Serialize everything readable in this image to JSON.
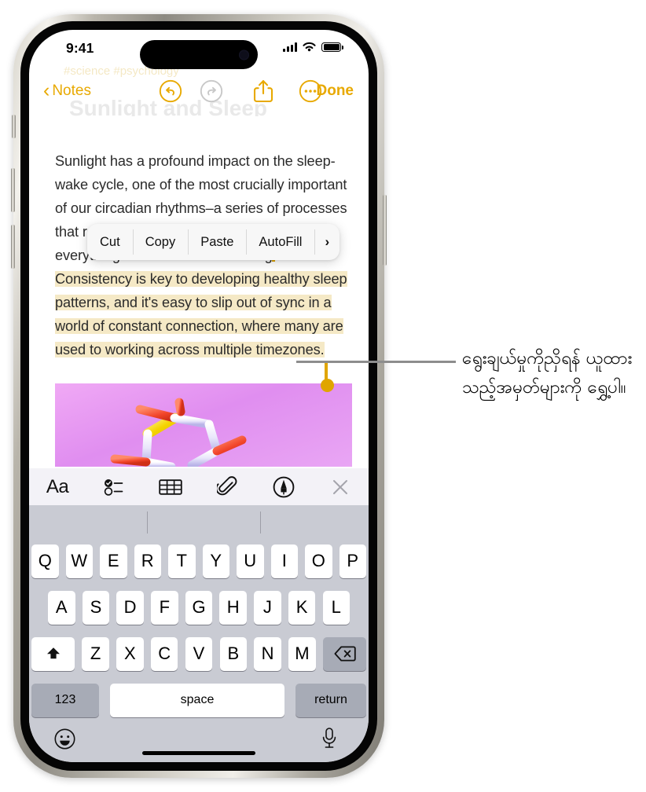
{
  "status_bar": {
    "time": "9:41",
    "signal_icon": "cellular-bars-icon",
    "wifi_icon": "wifi-icon",
    "battery_icon": "battery-full-icon"
  },
  "nav_bar": {
    "back_label": "Notes",
    "back_icon": "chevron-left-icon",
    "undo_icon": "undo-arrow-icon",
    "redo_icon": "redo-arrow-icon",
    "share_icon": "share-icon",
    "more_icon": "ellipsis-circle-icon",
    "done_label": "Done",
    "accent_color": "#e8a900",
    "disabled_color": "#c8c8c8"
  },
  "ghost": {
    "title": "Sunlight and Sleep",
    "tags": "#science #psychology"
  },
  "note": {
    "paragraph_before": "Sunlight has a profound impact on the sleep-wake cycle, one of the most crucially important of our circadian rhythms–a series of processes that regulate our bodies' functions to optimize everything from wakefulness to digestion. ",
    "paragraph_selected": "Consistency is key to developing healthy sleep patterns, and it's easy to slip out of sync in a world of constant connection, where many are used to working across multiple timezones.",
    "highlight_color": "#f5e9c6",
    "handle_color": "#e0a500",
    "image_name": "molecule-attachment-image"
  },
  "context_menu": {
    "items": [
      {
        "label": "Cut",
        "name": "context-menu-cut"
      },
      {
        "label": "Copy",
        "name": "context-menu-copy"
      },
      {
        "label": "Paste",
        "name": "context-menu-paste"
      },
      {
        "label": "AutoFill",
        "name": "context-menu-autofill"
      }
    ],
    "more_label": "›"
  },
  "notes_toolbar": {
    "format_label": "Aa",
    "items": [
      "format-text-icon",
      "checklist-icon",
      "table-icon",
      "attachment-paperclip-icon",
      "markup-pen-icon",
      "close-icon"
    ]
  },
  "keyboard": {
    "row1": [
      "Q",
      "W",
      "E",
      "R",
      "T",
      "Y",
      "U",
      "I",
      "O",
      "P"
    ],
    "row2": [
      "A",
      "S",
      "D",
      "F",
      "G",
      "H",
      "J",
      "K",
      "L"
    ],
    "row3": [
      "Z",
      "X",
      "C",
      "V",
      "B",
      "N",
      "M"
    ],
    "shift_icon": "shift-up-arrow-icon",
    "delete_icon": "delete-backspace-icon",
    "numbers_label": "123",
    "space_label": "space",
    "return_label": "return",
    "emoji_icon": "emoji-smiley-icon",
    "mic_icon": "microphone-icon"
  },
  "callout": {
    "text": "ရွေးချယ်မှုကိုညှိရန် ယူထားသည့်အမှတ်များကို ရွှေ့ပါ။"
  }
}
